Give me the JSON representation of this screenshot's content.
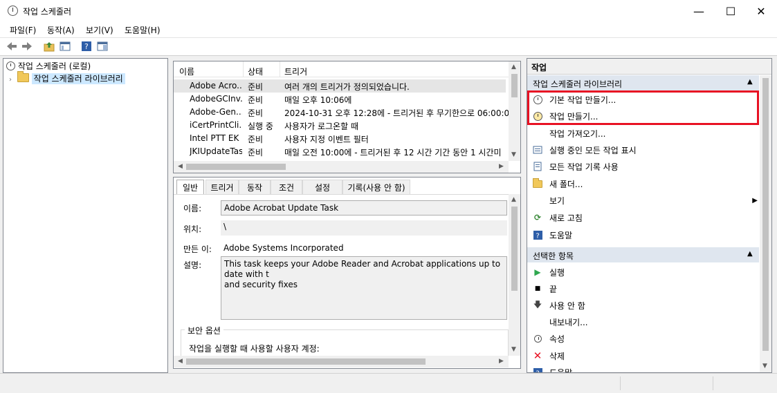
{
  "window": {
    "title": "작업 스케줄러",
    "minimize": "—",
    "maximize": "☐",
    "close": "✕"
  },
  "menu": [
    "파일(F)",
    "동작(A)",
    "보기(V)",
    "도움말(H)"
  ],
  "toolbar": {
    "icons": [
      "back-icon",
      "forward-icon",
      "up-folder-icon",
      "show-hide-tree-icon",
      "help-icon",
      "action-pane-icon"
    ]
  },
  "tree": {
    "root": "작업 스케줄러 (로컬)",
    "library": "작업 스케줄러 라이브러리"
  },
  "task_list": {
    "columns": [
      "이름",
      "상태",
      "트리거"
    ],
    "rows": [
      {
        "name": "Adobe Acro...",
        "status": "준비",
        "trigger": "여러 개의 트리거가 정의되었습니다."
      },
      {
        "name": "AdobeGCInv...",
        "status": "준비",
        "trigger": "매일 오후 10:06에"
      },
      {
        "name": "Adobe-Gen...",
        "status": "준비",
        "trigger": "2024-10-31 오후 12:28에 - 트리거된 후 무기한으로 06:00:0"
      },
      {
        "name": "iCertPrintCli...",
        "status": "실행 중",
        "trigger": "사용자가 로그온할 때"
      },
      {
        "name": "Intel PTT EK ...",
        "status": "준비",
        "trigger": "사용자 지정 이벤트 필터"
      },
      {
        "name": "JKIUpdateTask",
        "status": "준비",
        "trigger": "매일 오전 10:00에 - 트리거된 후 12 시간 기간 동안 1 시간미"
      }
    ]
  },
  "detail": {
    "tabs": [
      "일반",
      "트리거",
      "동작",
      "조건",
      "설정",
      "기록(사용 안 함)"
    ],
    "name_label": "이름:",
    "name_value": "Adobe Acrobat Update Task",
    "location_label": "위치:",
    "location_value": "\\",
    "author_label": "만든 이:",
    "author_value": "Adobe Systems Incorporated",
    "desc_label": "설명:",
    "desc_value": "This task keeps your Adobe Reader and Acrobat applications up to date with t\nand security fixes",
    "security_group": "보안 옵션",
    "run_as_label": "작업을 실행할 때 사용할 사용자 계정:"
  },
  "actions": {
    "header": "작업",
    "section1": "작업 스케줄러 라이브러리",
    "items1": [
      {
        "label": "기본 작업 만들기...",
        "icon": "basic-task-icon"
      },
      {
        "label": "작업 만들기...",
        "icon": "create-task-icon"
      },
      {
        "label": "작업 가져오기...",
        "icon": ""
      },
      {
        "label": "실행 중인 모든 작업 표시",
        "icon": "running-tasks-icon"
      },
      {
        "label": "모든 작업 기록 사용",
        "icon": "history-icon"
      },
      {
        "label": "새 폴더...",
        "icon": "new-folder-icon"
      },
      {
        "label": "보기",
        "icon": ""
      },
      {
        "label": "새로 고침",
        "icon": "refresh-icon"
      },
      {
        "label": "도움말",
        "icon": "help-icon"
      }
    ],
    "section2": "선택한 항목",
    "items2": [
      {
        "label": "실행",
        "icon": "run-icon"
      },
      {
        "label": "끝",
        "icon": "end-icon"
      },
      {
        "label": "사용 안 함",
        "icon": "disable-icon"
      },
      {
        "label": "내보내기...",
        "icon": ""
      },
      {
        "label": "속성",
        "icon": "properties-icon"
      },
      {
        "label": "삭제",
        "icon": "delete-icon"
      },
      {
        "label": "도움말",
        "icon": "help-icon"
      }
    ]
  },
  "colors": {
    "highlight_box": "#e81123",
    "selection": "#cce8ff",
    "section_header": "#dfe6ef"
  }
}
